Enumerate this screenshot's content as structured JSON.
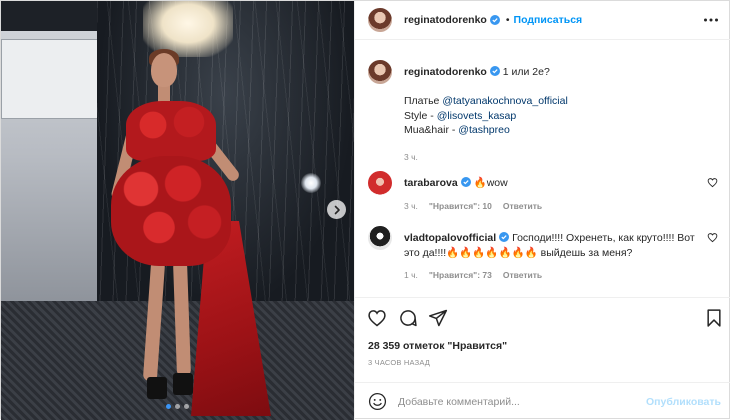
{
  "post": {
    "author": "reginatodorenko",
    "follow_label": "Подписаться",
    "follow_separator": "•"
  },
  "photo": {
    "slide_index": 1,
    "slide_count": 3
  },
  "caption": {
    "author": "reginatodorenko",
    "first_line": "1 или 2е?",
    "dress_prefix": "Платье ",
    "dress_mention": "@tatyanakochnova_official",
    "style_prefix": "Style - ",
    "style_mention": "@lisovets_kasap",
    "mua_prefix": "Mua&hair - ",
    "mua_mention": "@tashpreo",
    "time": "3 ч."
  },
  "comments": [
    {
      "author": "tarabarova",
      "text": "🔥wow",
      "time": "3 ч.",
      "likes": "\"Нравится\": 10",
      "reply": "Ответить"
    },
    {
      "author": "vladtopalovofficial",
      "text": "Господи!!!! Охренеть, как круто!!!! Вот это да!!!!🔥🔥🔥🔥🔥🔥🔥 выйдешь за меня?",
      "time": "1 ч.",
      "likes": "\"Нравится\": 73",
      "reply": "Ответить"
    }
  ],
  "stats": {
    "likes": "28 359 отметок \"Нравится\"",
    "ago": "3 ЧАСОВ НАЗАД"
  },
  "composer": {
    "placeholder": "Добавьте комментарий...",
    "publish_label": "Опубликовать"
  },
  "icons": {
    "verified": "verified-badge-icon",
    "more": "more-options-icon",
    "like": "heart-icon",
    "comment": "comment-icon",
    "share": "paper-plane-icon",
    "save": "bookmark-icon",
    "emoji": "emoji-smile-icon",
    "next": "chevron-right-icon"
  },
  "colors": {
    "link": "#00376b",
    "accent": "#0095f6",
    "verified": "#3897f0",
    "muted": "#8e8e8e",
    "publish_disabled": "#b2dffc"
  }
}
